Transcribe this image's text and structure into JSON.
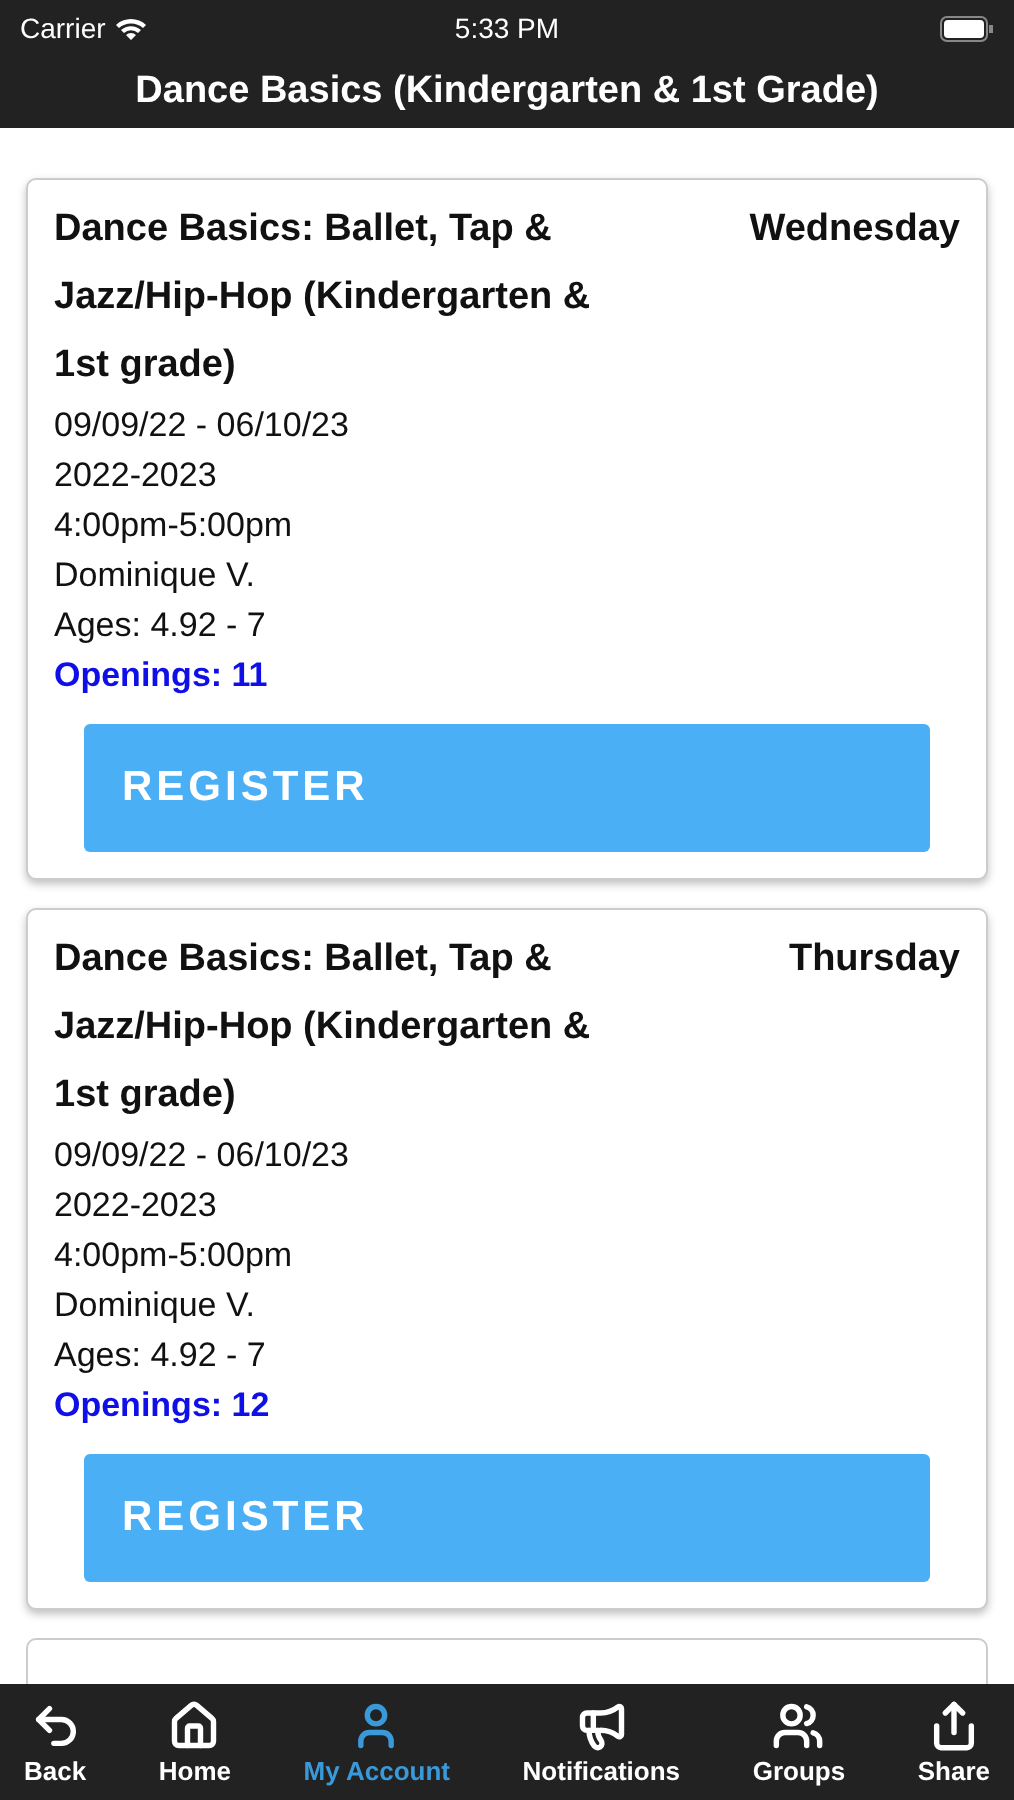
{
  "status_bar": {
    "carrier": "Carrier",
    "time": "5:33 PM"
  },
  "nav_bar": {
    "title": "Dance Basics (Kindergarten & 1st Grade)"
  },
  "classes": [
    {
      "title": "Dance Basics: Ballet, Tap & Jazz/Hip-Hop (Kindergarten & 1st grade)",
      "day": "Wednesday",
      "dates": "09/09/22 - 06/10/23",
      "season": "2022-2023",
      "time": "4:00pm-5:00pm",
      "instructor": "Dominique V.",
      "ages": "Ages: 4.92 - 7",
      "openings": "Openings: 11",
      "button": "REGISTER"
    },
    {
      "title": "Dance Basics: Ballet, Tap & Jazz/Hip-Hop (Kindergarten & 1st grade)",
      "day": "Thursday",
      "dates": "09/09/22 - 06/10/23",
      "season": "2022-2023",
      "time": "4:00pm-5:00pm",
      "instructor": "Dominique V.",
      "ages": "Ages: 4.92 - 7",
      "openings": "Openings: 12",
      "button": "REGISTER"
    }
  ],
  "tab_bar": [
    {
      "kind": "back",
      "label": "Back",
      "selected": false
    },
    {
      "kind": "home",
      "label": "Home",
      "selected": false
    },
    {
      "kind": "account",
      "label": "My Account",
      "selected": true
    },
    {
      "kind": "notifications",
      "label": "Notifications",
      "selected": false
    },
    {
      "kind": "groups",
      "label": "Groups",
      "selected": false
    },
    {
      "kind": "share",
      "label": "Share",
      "selected": false
    }
  ]
}
